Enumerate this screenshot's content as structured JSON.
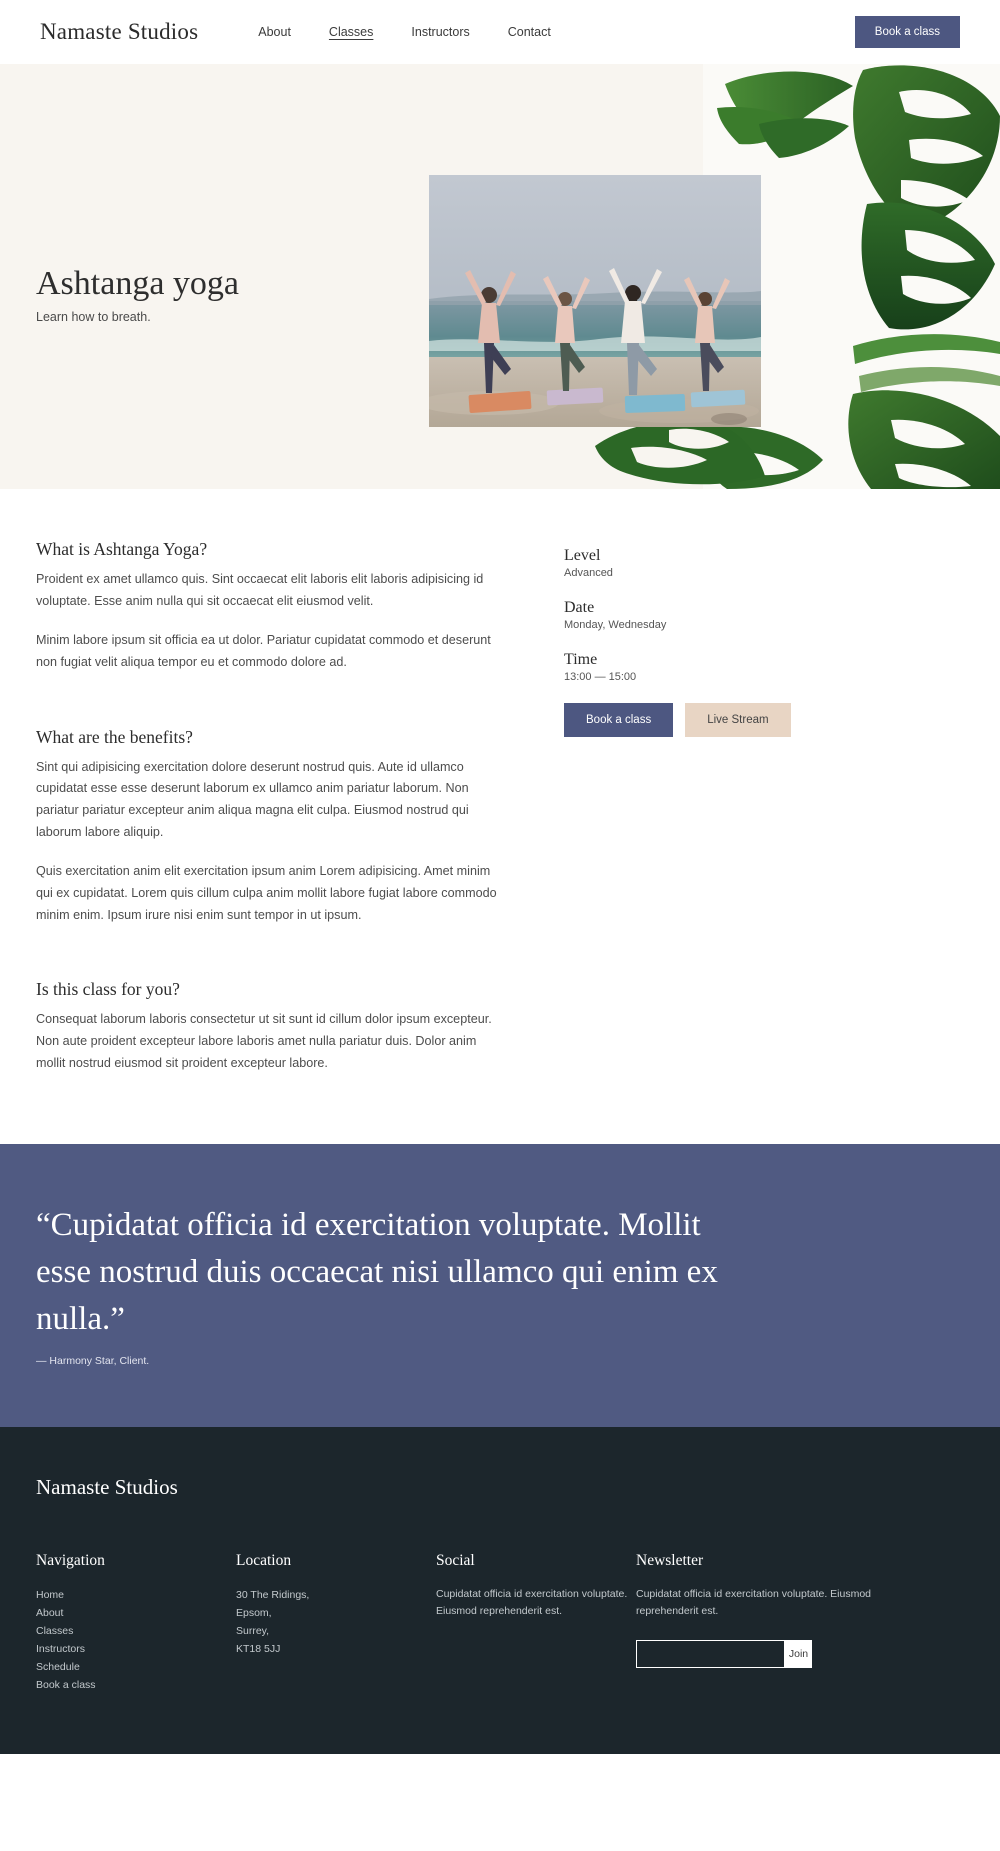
{
  "header": {
    "brand": "Namaste Studios",
    "nav": [
      {
        "label": "About",
        "active": false
      },
      {
        "label": "Classes",
        "active": true
      },
      {
        "label": "Instructors",
        "active": false
      },
      {
        "label": "Contact",
        "active": false
      }
    ],
    "cta_label": "Book a class"
  },
  "hero": {
    "title": "Ashtanga yoga",
    "subtitle": "Learn how to breath.",
    "photo_alt": "Five people practising tree pose on yoga mats on a beach at the shoreline",
    "decor_alt": "Monstera deliciosa leaves",
    "background_color": "#f8f5f0",
    "panel_color": "#fbfaf7"
  },
  "main": {
    "sections": [
      {
        "heading": "What is Ashtanga Yoga?",
        "paragraphs": [
          "Proident ex amet ullamco quis. Sint occaecat elit laboris elit laboris adipisicing id voluptate. Esse anim nulla qui sit occaecat elit eiusmod velit.",
          "Minim labore ipsum sit officia ea ut dolor. Pariatur cupidatat commodo et deserunt non fugiat velit aliqua tempor eu et commodo dolore ad."
        ]
      },
      {
        "heading": "What are the benefits?",
        "paragraphs": [
          "Sint qui adipisicing exercitation dolore deserunt nostrud quis. Aute id ullamco cupidatat esse esse deserunt laborum ex ullamco anim pariatur laborum. Non pariatur pariatur excepteur anim aliqua magna elit culpa. Eiusmod nostrud qui laborum labore aliquip.",
          "Quis exercitation anim elit exercitation ipsum anim Lorem adipisicing. Amet minim qui ex cupidatat. Lorem quis cillum culpa anim mollit labore fugiat labore commodo minim enim. Ipsum irure nisi enim sunt tempor in ut ipsum."
        ]
      },
      {
        "heading": "Is this class for you?",
        "paragraphs": [
          "Consequat laborum laboris consectetur ut sit sunt id cillum dolor ipsum excepteur. Non aute proident excepteur labore laboris amet nulla pariatur duis. Dolor anim mollit nostrud eiusmod sit proident excepteur labore."
        ]
      }
    ]
  },
  "details": {
    "items": [
      {
        "label": "Level",
        "value": "Advanced"
      },
      {
        "label": "Date",
        "value": "Monday, Wednesday"
      },
      {
        "label": "Time",
        "value": "13:00 — 15:00"
      }
    ],
    "book_label": "Book a class",
    "live_label": "Live Stream",
    "book_color": "#4d5781",
    "live_color": "#e8d5c4"
  },
  "quote": {
    "text": "“Cupidatat officia id exercitation voluptate. Mollit esse nostrud duis occaecat nisi ullamco qui enim ex nulla.”",
    "attribution": "— Harmony Star, Client.",
    "background_color": "#505a82"
  },
  "footer": {
    "brand": "Namaste Studios",
    "background_color": "#1c262c",
    "navigation": {
      "title": "Navigation",
      "items": [
        "Home",
        "About",
        "Classes",
        "Instructors",
        "Schedule",
        "Book a class"
      ]
    },
    "location": {
      "title": "Location",
      "lines": [
        "30 The Ridings,",
        "Epsom,",
        "Surrey,",
        "KT18 5JJ"
      ]
    },
    "social": {
      "title": "Social",
      "text": "Cupidatat officia id exercitation voluptate. Eiusmod reprehenderit est."
    },
    "newsletter": {
      "title": "Newsletter",
      "text": "Cupidatat officia id exercitation voluptate. Eiusmod reprehenderit est.",
      "input_value": "",
      "input_placeholder": "",
      "join_label": "Join"
    }
  }
}
